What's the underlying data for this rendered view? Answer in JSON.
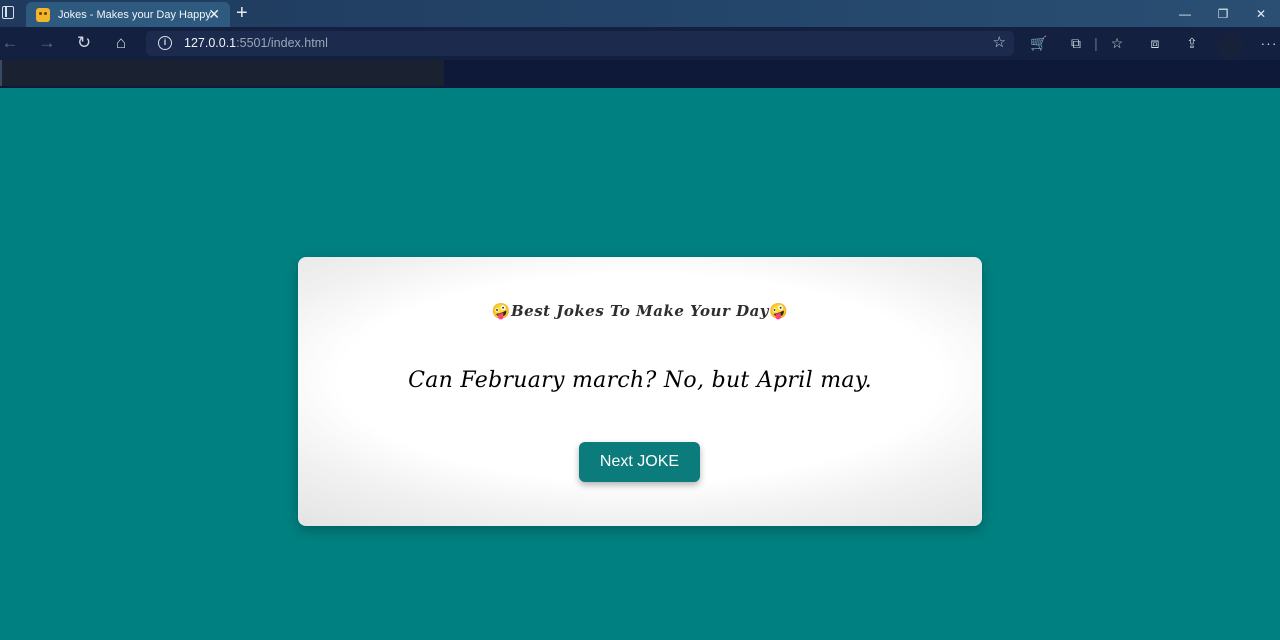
{
  "browser": {
    "tab": {
      "title": "Jokes - Makes your Day Happy",
      "close": "✕"
    },
    "new_tab": "+",
    "url": {
      "host": "127.0.0.1",
      "rest": ":5501/index.html"
    },
    "window_controls": {
      "minimize": "—",
      "maximize": "❐",
      "close": "✕"
    }
  },
  "card": {
    "heading_emoji": "🤪",
    "heading": "Best Jokes To Make Your Day",
    "joke": "Can February march? No, but April may.",
    "next_button": "Next JOKE"
  },
  "colors": {
    "page_background": "#008080",
    "button": "#0b7b7b"
  }
}
